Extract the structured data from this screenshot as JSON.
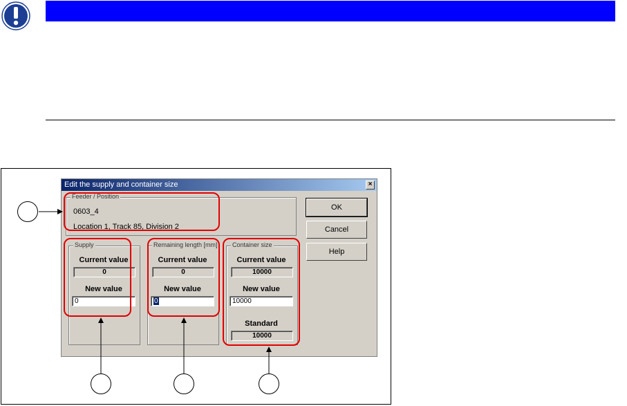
{
  "dialog": {
    "title": "Edit the supply and container size",
    "close_symbol": "×",
    "feeder": {
      "group_label": "Feeder / Position",
      "name": "0603_4",
      "location": "Location 1, Track 85, Division 2"
    },
    "supply": {
      "group_label": "Supply",
      "current_label": "Current value",
      "current_value": "0",
      "new_label": "New value",
      "new_value": "0"
    },
    "remaining": {
      "group_label": "Remaining length [mm]",
      "current_label": "Current value",
      "current_value": "0",
      "new_label": "New value",
      "new_value": "0"
    },
    "container": {
      "group_label": "Container size",
      "current_label": "Current value",
      "current_value": "10000",
      "new_label": "New value",
      "new_value": "10000",
      "standard_label": "Standard",
      "standard_value": "10000"
    },
    "buttons": {
      "ok": "OK",
      "cancel": "Cancel",
      "help": "Help"
    }
  },
  "colors": {
    "notice_bar": "#0000ff",
    "highlight": "#e00000",
    "titlebar_start": "#0a246a",
    "titlebar_end": "#a6caf0",
    "dialog_face": "#d4d0c8"
  },
  "icons": {
    "notice": "exclamation-icon"
  }
}
